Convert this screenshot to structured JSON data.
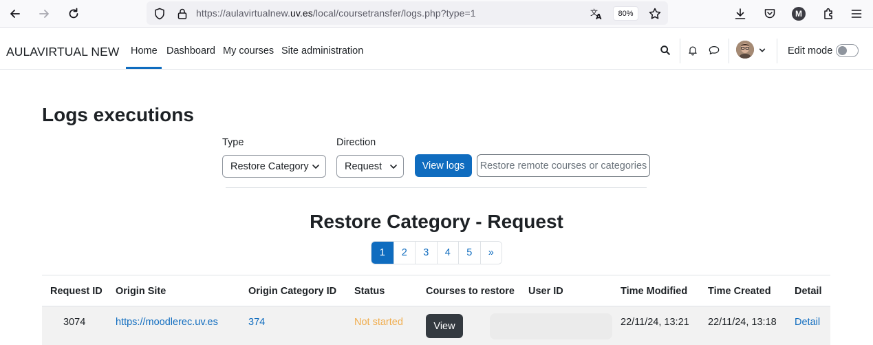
{
  "browser": {
    "url_prefix": "https://aulavirtualnew.",
    "url_host": "uv.es",
    "url_suffix": "/local/coursetransfer/logs.php?type=1",
    "zoom": "80%",
    "account_initial": "M"
  },
  "navbar": {
    "brand": "AULAVIRTUAL NEW",
    "items": [
      {
        "label": "Home"
      },
      {
        "label": "Dashboard"
      },
      {
        "label": "My courses"
      },
      {
        "label": "Site administration"
      }
    ],
    "edit_mode_label": "Edit mode"
  },
  "page": {
    "title": "Logs executions"
  },
  "filters": {
    "type_label": "Type",
    "type_value": "Restore Category",
    "direction_label": "Direction",
    "direction_value": "Request",
    "view_button": "View logs",
    "restore_button": "Restore remote courses or categories"
  },
  "section": {
    "title": "Restore Category - Request"
  },
  "pagination": {
    "pages": [
      "1",
      "2",
      "3",
      "4",
      "5"
    ],
    "next": "»",
    "current": "1"
  },
  "table": {
    "headers": [
      "Request ID",
      "Origin Site",
      "Origin Category ID",
      "Status",
      "Courses to restore",
      "User ID",
      "Time Modified",
      "Time Created",
      "Detail"
    ],
    "rows": [
      {
        "request_id": "3074",
        "origin_site": "https://moodlerec.uv.es",
        "origin_category_id": "374",
        "status": "Not started",
        "courses_button": "View",
        "user_id": "",
        "time_modified": "22/11/24, 13:21",
        "time_created": "22/11/24, 13:18",
        "detail": "Detail"
      }
    ]
  },
  "colors": {
    "primary": "#0f6cbf",
    "status_not_started": "#f0ad4e",
    "dark_button": "#343a40"
  }
}
